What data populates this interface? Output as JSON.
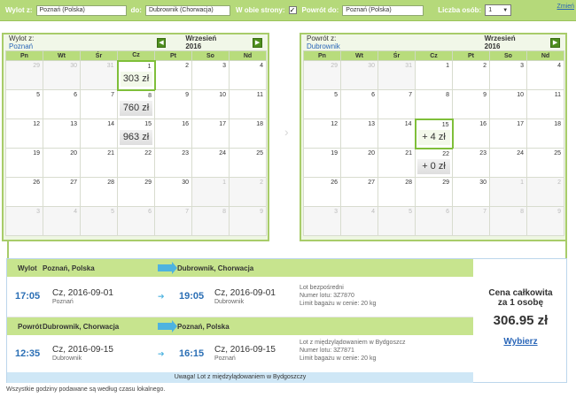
{
  "search": {
    "from_label": "Wylot z:",
    "from_value": "Poznań (Polska)",
    "to_label": "do:",
    "to_value": "Dubrownik (Chorwacja)",
    "both_ways_label": "W obie strony:",
    "both_ways_checked": "✓",
    "return_label": "Powrót do:",
    "return_value": "Poznań (Polska)",
    "pax_label": "Liczba osób:",
    "pax_value": "1",
    "change_link": "Zmień"
  },
  "weekdays": [
    "Pn",
    "Wt",
    "Śr",
    "Cz",
    "Pt",
    "So",
    "Nd"
  ],
  "outbound_cal": {
    "title_prefix": "Wylot z:",
    "title_city": "Poznań",
    "month": "Wrzesień 2016",
    "prev": "◀",
    "next": "▶",
    "rows": [
      [
        {
          "d": "29",
          "o": true
        },
        {
          "d": "30",
          "o": true
        },
        {
          "d": "31",
          "o": true
        },
        {
          "d": "1",
          "p": "303 zł",
          "s": true
        },
        {
          "d": "2"
        },
        {
          "d": "3"
        },
        {
          "d": "4"
        }
      ],
      [
        {
          "d": "5"
        },
        {
          "d": "6"
        },
        {
          "d": "7"
        },
        {
          "d": "8",
          "p": "760 zł"
        },
        {
          "d": "9"
        },
        {
          "d": "10"
        },
        {
          "d": "11"
        }
      ],
      [
        {
          "d": "12"
        },
        {
          "d": "13"
        },
        {
          "d": "14"
        },
        {
          "d": "15",
          "p": "963 zł"
        },
        {
          "d": "16"
        },
        {
          "d": "17"
        },
        {
          "d": "18"
        }
      ],
      [
        {
          "d": "19"
        },
        {
          "d": "20"
        },
        {
          "d": "21"
        },
        {
          "d": "22"
        },
        {
          "d": "23"
        },
        {
          "d": "24"
        },
        {
          "d": "25"
        }
      ],
      [
        {
          "d": "26"
        },
        {
          "d": "27"
        },
        {
          "d": "28"
        },
        {
          "d": "29"
        },
        {
          "d": "30"
        },
        {
          "d": "1",
          "o": true
        },
        {
          "d": "2",
          "o": true
        }
      ],
      [
        {
          "d": "3",
          "o": true
        },
        {
          "d": "4",
          "o": true
        },
        {
          "d": "5",
          "o": true
        },
        {
          "d": "6",
          "o": true
        },
        {
          "d": "7",
          "o": true
        },
        {
          "d": "8",
          "o": true
        },
        {
          "d": "9",
          "o": true
        }
      ]
    ]
  },
  "return_cal": {
    "title_prefix": "Powrót z:",
    "title_city": "Dubrownik",
    "month": "Wrzesień 2016",
    "next": "▶",
    "rows": [
      [
        {
          "d": "29",
          "o": true
        },
        {
          "d": "30",
          "o": true
        },
        {
          "d": "31",
          "o": true
        },
        {
          "d": "1"
        },
        {
          "d": "2"
        },
        {
          "d": "3"
        },
        {
          "d": "4"
        }
      ],
      [
        {
          "d": "5"
        },
        {
          "d": "6"
        },
        {
          "d": "7"
        },
        {
          "d": "8"
        },
        {
          "d": "9"
        },
        {
          "d": "10"
        },
        {
          "d": "11"
        }
      ],
      [
        {
          "d": "12"
        },
        {
          "d": "13"
        },
        {
          "d": "14"
        },
        {
          "d": "15",
          "p": "+ 4 zł",
          "s": true
        },
        {
          "d": "16"
        },
        {
          "d": "17"
        },
        {
          "d": "18"
        }
      ],
      [
        {
          "d": "19"
        },
        {
          "d": "20"
        },
        {
          "d": "21"
        },
        {
          "d": "22",
          "p": "+ 0 zł"
        },
        {
          "d": "23"
        },
        {
          "d": "24"
        },
        {
          "d": "25"
        }
      ],
      [
        {
          "d": "26"
        },
        {
          "d": "27"
        },
        {
          "d": "28"
        },
        {
          "d": "29"
        },
        {
          "d": "30"
        },
        {
          "d": "1",
          "o": true
        },
        {
          "d": "2",
          "o": true
        }
      ],
      [
        {
          "d": "3",
          "o": true
        },
        {
          "d": "4",
          "o": true
        },
        {
          "d": "5",
          "o": true
        },
        {
          "d": "6",
          "o": true
        },
        {
          "d": "7",
          "o": true
        },
        {
          "d": "8",
          "o": true
        },
        {
          "d": "9",
          "o": true
        }
      ]
    ]
  },
  "outbound": {
    "dir_label": "Wylot",
    "from": "Poznań, Polska",
    "to": "Dubrownik, Chorwacja",
    "dep_time": "17:05",
    "dep_date": "Cz, 2016-09-01",
    "dep_city": "Poznań",
    "arr_time": "19:05",
    "arr_date": "Cz, 2016-09-01",
    "arr_city": "Dubrownik",
    "info1": "Lot bezpośredni",
    "info2": "Numer lotu: 3Z7870",
    "info3": "Limit bagażu w cenie: 20 kg"
  },
  "return": {
    "dir_label": "Powrót",
    "from": "Dubrownik, Chorwacja",
    "to": "Poznań, Polska",
    "dep_time": "12:35",
    "dep_date": "Cz, 2016-09-15",
    "dep_city": "Dubrownik",
    "arr_time": "16:15",
    "arr_date": "Cz, 2016-09-15",
    "arr_city": "Poznań",
    "info1": "Lot z międzylądowaniem w Bydgoszcz",
    "info2": "Numer lotu: 3Z7871",
    "info3": "Limit bagażu w cenie: 20 kg"
  },
  "warning": "Uwaga! Lot z międzylądowaniem w Bydgoszczy",
  "price": {
    "label1": "Cena całkowita",
    "label2": "za 1 osobę",
    "total": "306.95 zł",
    "choose": "Wybierz"
  },
  "footnote": "Wszystkie godziny podawane są według czasu lokalnego."
}
